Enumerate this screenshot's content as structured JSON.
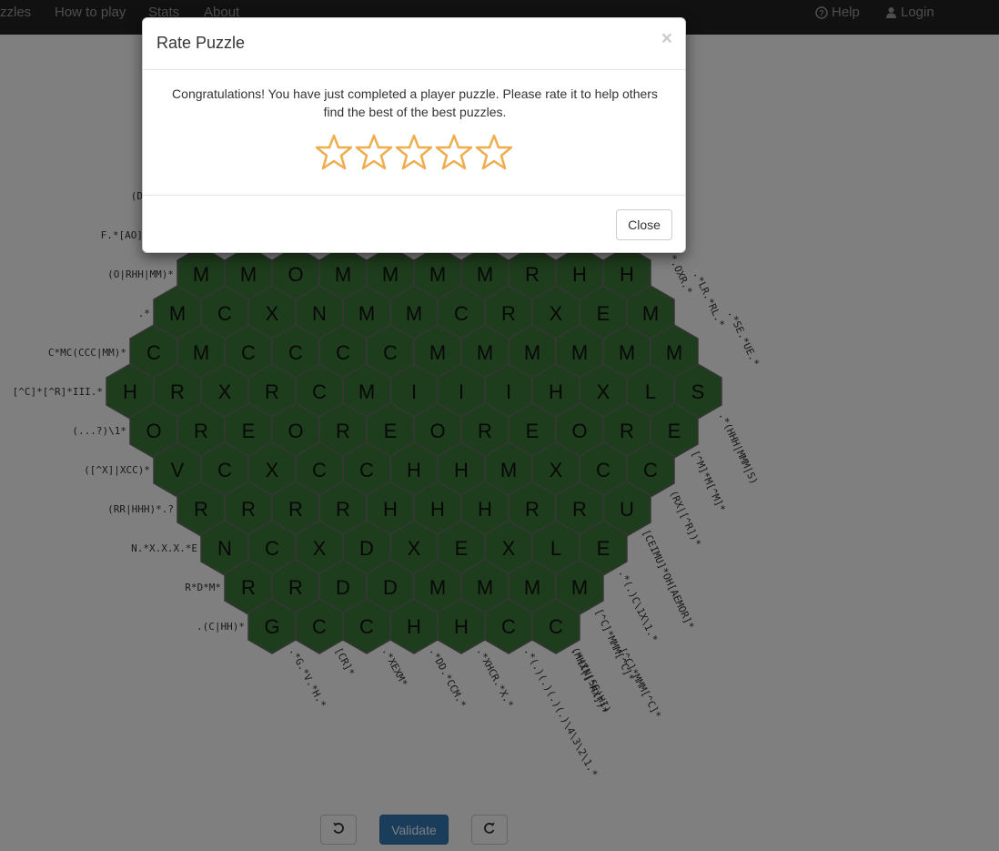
{
  "navbar": {
    "items": [
      "zzles",
      "How to play",
      "Stats",
      "About"
    ],
    "help_label": "Help",
    "login_label": "Login",
    "help_icon": "question-circle-icon",
    "login_icon": "user-icon"
  },
  "colors": {
    "cell": "#3c7a3a",
    "cell_border": "#2a2a2a",
    "navbar": "#222222",
    "validate": "#337ab7",
    "star": "#f0ad4e"
  },
  "board": {
    "rows": [
      [
        "M",
        "M",
        "O",
        "M",
        "M",
        "M",
        "M",
        "R",
        "H",
        "H"
      ],
      [
        "M",
        "C",
        "X",
        "N",
        "M",
        "M",
        "C",
        "R",
        "X",
        "E",
        "M"
      ],
      [
        "C",
        "M",
        "C",
        "C",
        "C",
        "C",
        "M",
        "M",
        "M",
        "M",
        "M",
        "M"
      ],
      [
        "H",
        "R",
        "X",
        "R",
        "C",
        "M",
        "I",
        "I",
        "I",
        "H",
        "X",
        "L",
        "S"
      ],
      [
        "O",
        "R",
        "E",
        "O",
        "R",
        "E",
        "O",
        "R",
        "E",
        "O",
        "R",
        "E"
      ],
      [
        "V",
        "C",
        "X",
        "C",
        "C",
        "H",
        "H",
        "M",
        "X",
        "C",
        "C"
      ],
      [
        "R",
        "R",
        "R",
        "R",
        "H",
        "H",
        "H",
        "R",
        "R",
        "U"
      ],
      [
        "N",
        "C",
        "X",
        "D",
        "X",
        "E",
        "X",
        "L",
        "E"
      ],
      [
        "R",
        "R",
        "D",
        "D",
        "M",
        "M",
        "M",
        "M"
      ],
      [
        "G",
        "C",
        "C",
        "H",
        "H",
        "C",
        "C"
      ]
    ],
    "left_clues_visible": [
      "(D",
      "F.*[AO]",
      "(O|RHH|MM)*",
      ".*",
      "C*MC(CCC|MM)*",
      "[^C]*[^R]*III.*",
      "(...?)\\1*",
      "([^X]|XCC)*",
      "(RR|HHH)*.?",
      "N.*X.X.X.*E",
      "R*D*M*",
      ".(C|HH)*"
    ],
    "right_clues": [
      "*.OXR.*",
      ".*LR.*RL.*",
      ".*SE.*UE.*",
      ".*(HHH|MMM|S)",
      "[^M]*M[^M]*",
      "(RX|[^R])*",
      "[CEIMU]*OH[AEMOR]*",
      ".*(.)C\\1X\\1.*",
      "[^C]*MMM[^C]*",
      "(HHX|[^HX])*"
    ],
    "bottom_clues": [
      ".*G.*V.*H.*",
      "[CR]*",
      ".*XEXM*",
      ".*DD.*CCM.*",
      ".*XHCR.*X.*",
      ".*(.)(.)(.)(.)\\4\\3\\2\\1.*",
      ".*(IN|SE|HI)",
      "[^C]*MMM[^C]*"
    ]
  },
  "toolbar": {
    "undo_icon": "undo-icon",
    "redo_icon": "redo-icon",
    "validate_label": "Validate"
  },
  "modal": {
    "title": "Rate Puzzle",
    "close_x": "×",
    "message": "Congratulations! You have just completed a player puzzle. Please rate it to help others find the best of the best puzzles.",
    "rating": 0,
    "rating_max": 5,
    "close_label": "Close"
  }
}
